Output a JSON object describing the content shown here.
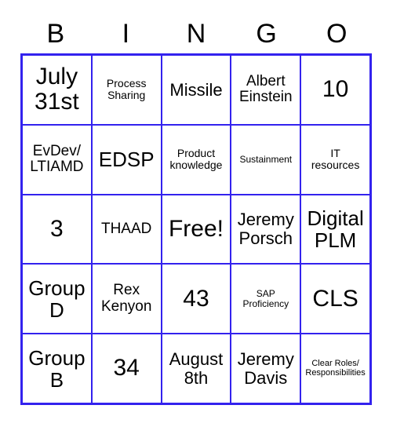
{
  "card": {
    "title": "BINGO",
    "header_letters": [
      "B",
      "I",
      "N",
      "G",
      "O"
    ],
    "grid_color": "#3322EE",
    "text_color": "#000000",
    "background_color": "#FFFFFF",
    "rows": 5,
    "columns": 5,
    "free_space_label": "Free!",
    "cells": [
      [
        {
          "text": "July\n31st",
          "size": "xl"
        },
        {
          "text": "Process\nSharing",
          "size": "xs"
        },
        {
          "text": "Missile",
          "size": "md"
        },
        {
          "text": "Albert\nEinstein",
          "size": "sm"
        },
        {
          "text": "10",
          "size": "xl"
        }
      ],
      [
        {
          "text": "EvDev/\nLTIAMD",
          "size": "sm"
        },
        {
          "text": "EDSP",
          "size": "lg"
        },
        {
          "text": "Product\nknowledge",
          "size": "xs"
        },
        {
          "text": "Sustainment",
          "size": "xxs"
        },
        {
          "text": "IT\nresources",
          "size": "xs"
        }
      ],
      [
        {
          "text": "3",
          "size": "xl"
        },
        {
          "text": "THAAD",
          "size": "sm"
        },
        {
          "text": "Free!",
          "size": "xl"
        },
        {
          "text": "Jeremy\nPorsch",
          "size": "md"
        },
        {
          "text": "Digital\nPLM",
          "size": "lg"
        }
      ],
      [
        {
          "text": "Group\nD",
          "size": "lg"
        },
        {
          "text": "Rex\nKenyon",
          "size": "sm"
        },
        {
          "text": "43",
          "size": "xl"
        },
        {
          "text": "SAP\nProficiency",
          "size": "xxs"
        },
        {
          "text": "CLS",
          "size": "xl"
        }
      ],
      [
        {
          "text": "Group\nB",
          "size": "lg"
        },
        {
          "text": "34",
          "size": "xl"
        },
        {
          "text": "August\n8th",
          "size": "md"
        },
        {
          "text": "Jeremy\nDavis",
          "size": "md"
        },
        {
          "text": "Clear Roles/\nResponsibilities",
          "size": "tiny"
        }
      ]
    ]
  }
}
